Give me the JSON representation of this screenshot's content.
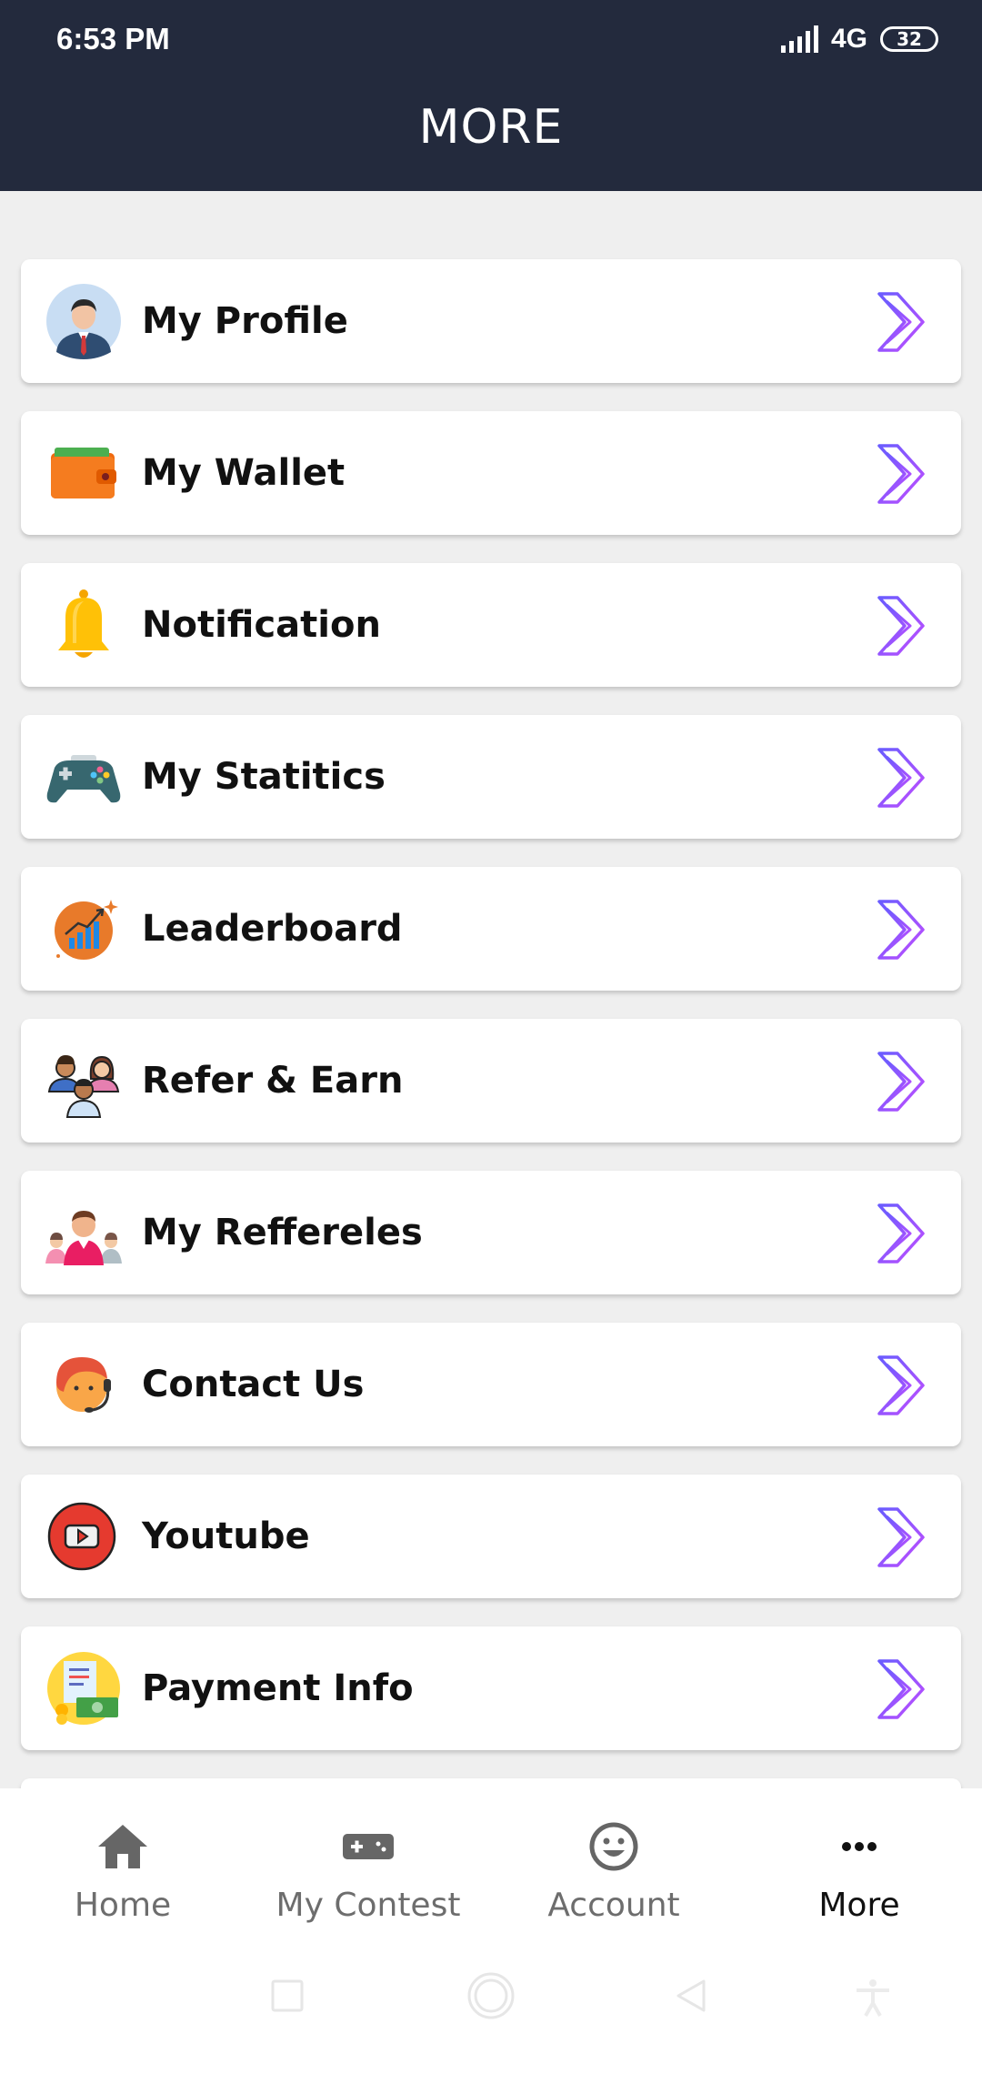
{
  "status_bar": {
    "time": "6:53 PM",
    "network": "4G",
    "battery": "32"
  },
  "header": {
    "title": "MORE"
  },
  "menu": {
    "items": [
      {
        "label": "My Profile",
        "icon": "profile-avatar-icon"
      },
      {
        "label": "My Wallet",
        "icon": "wallet-icon"
      },
      {
        "label": "Notification",
        "icon": "bell-icon"
      },
      {
        "label": "My Statitics",
        "icon": "gamepad-icon"
      },
      {
        "label": "Leaderboard",
        "icon": "growth-chart-icon"
      },
      {
        "label": "Refer & Earn",
        "icon": "people-group-icon"
      },
      {
        "label": "My Reffereles",
        "icon": "team-icon"
      },
      {
        "label": "Contact Us",
        "icon": "support-agent-icon"
      },
      {
        "label": "Youtube",
        "icon": "youtube-play-icon"
      },
      {
        "label": "Payment Info",
        "icon": "payment-receipt-icon"
      }
    ]
  },
  "bottom_nav": {
    "tabs": [
      {
        "label": "Home",
        "icon": "home-icon",
        "active": false
      },
      {
        "label": "My Contest",
        "icon": "gamepad-icon",
        "active": false
      },
      {
        "label": "Account",
        "icon": "smiley-icon",
        "active": false
      },
      {
        "label": "More",
        "icon": "more-dots-icon",
        "active": true
      }
    ]
  },
  "colors": {
    "header_bg": "#232a3d",
    "page_bg": "#efefef",
    "chevron_start": "#6a5cff",
    "chevron_end": "#c04dff",
    "nav_inactive": "#6d6d6d",
    "nav_active": "#111111"
  }
}
